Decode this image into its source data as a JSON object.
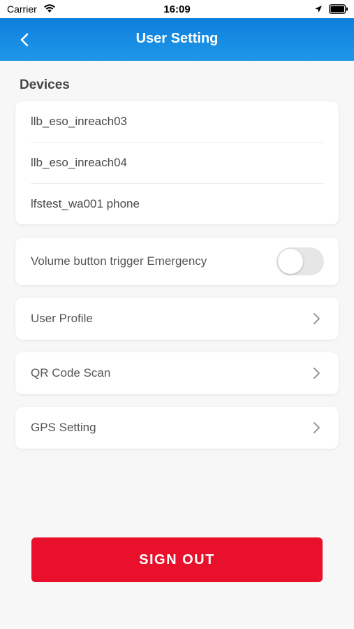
{
  "status_bar": {
    "carrier": "Carrier",
    "time": "16:09"
  },
  "nav": {
    "title": "User Setting",
    "back_icon": "chevron-left-icon"
  },
  "devices": {
    "section_title": "Devices",
    "items": [
      {
        "label": "llb_eso_inreach03"
      },
      {
        "label": "llb_eso_inreach04"
      },
      {
        "label": "lfstest_wa001 phone"
      }
    ]
  },
  "settings": {
    "volume_toggle": {
      "label": "Volume button trigger Emergency",
      "on": false
    },
    "rows": [
      {
        "label": "User Profile",
        "icon": "chevron-right-icon"
      },
      {
        "label": "QR Code Scan",
        "icon": "chevron-right-icon"
      },
      {
        "label": "GPS Setting",
        "icon": "chevron-right-icon"
      }
    ]
  },
  "sign_out": {
    "label": "SIGN OUT"
  },
  "colors": {
    "nav_gradient_start": "#0e7fdc",
    "nav_gradient_end": "#1f97e9",
    "sign_out": "#e8102a",
    "background": "#f7f7f7"
  }
}
